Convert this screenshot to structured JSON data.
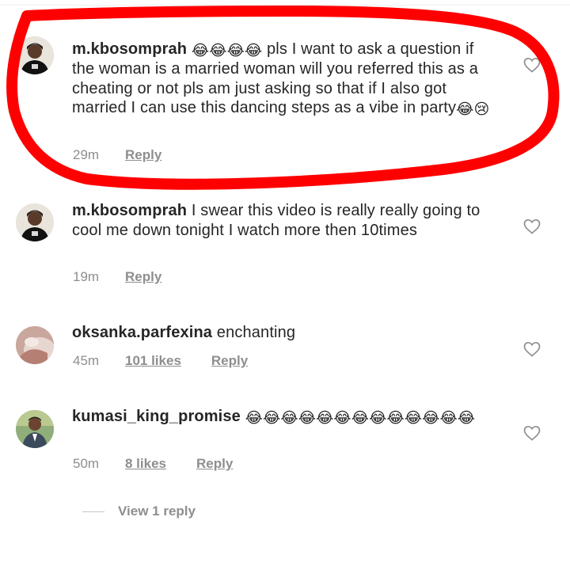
{
  "comments": [
    {
      "username": "m.kbosomprah",
      "text_before": " ",
      "emojis_lead": "😂😂😂😂",
      "text": " pls I want to ask a question if the woman is a married woman will you referred this as a cheating or not pls am just asking so that if I also got married I can use this dancing steps as a vibe in party",
      "emojis_trail": "😂😢",
      "time": "29m",
      "reply_label": "Reply"
    },
    {
      "username": "m.kbosomprah",
      "text": " I swear this video is really really going to cool me down tonight I watch more then 10times",
      "time": "19m",
      "reply_label": "Reply"
    },
    {
      "username": "oksanka.parfexina",
      "text": " enchanting",
      "time": "45m",
      "likes": "101 likes",
      "reply_label": "Reply"
    },
    {
      "username": "kumasi_king_promise",
      "emojis": "😂😂😂😂😂😂😂😂😂😂😂😂😂",
      "time": "50m",
      "likes": "8 likes",
      "reply_label": "Reply"
    }
  ],
  "view_replies_label": "View 1 reply",
  "colors": {
    "annotation": "#ff0000",
    "meta_text": "#8e8e8e",
    "primary_text": "#262626"
  },
  "icons": {
    "like": "heart-outline-icon"
  }
}
